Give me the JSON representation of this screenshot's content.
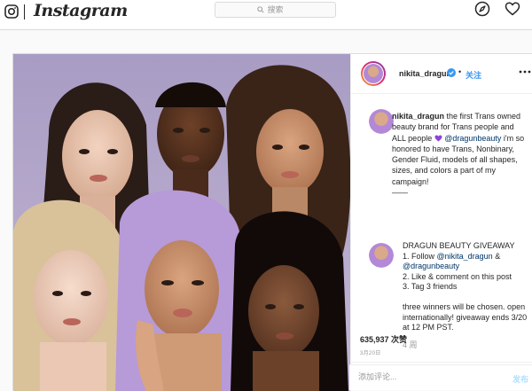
{
  "nav": {
    "logo_text": "Instagram",
    "search_placeholder": "搜索",
    "icons": [
      "camera-icon",
      "compass-icon",
      "heart-icon"
    ]
  },
  "post": {
    "username": "nikita_dragun",
    "follow_label": "关注",
    "header_dot": "•",
    "caption": {
      "user": "nikita_dragun",
      "text_1": " the first Trans owned beauty brand for Trans people and ALL people ",
      "mention_1": "@dragunbeauty",
      "text_2": " i'm so honored to have Trans, Nonbinary, Gender Fluid, models of all shapes, sizes, and colors a part of my campaign!",
      "divider": "——"
    },
    "comment": {
      "line_1": "DRAGUN BEAUTY GIVEAWAY",
      "line_2a": "1. Follow ",
      "mention_2": "@nikita_dragun",
      "line_2b": " &",
      "mention_3": "@dragunbeauty",
      "line_3": "2. Like & comment on this post",
      "line_4": "3. Tag 3 friends",
      "line_5": "three winners will be chosen. open internationally! giveaway ends 3/20 at 12 PM PST.",
      "time_ago": "4 周"
    },
    "likes_text": "635,937 次赞",
    "date_text": "3月20日",
    "comment_placeholder": "添加评论...",
    "post_button": "发布",
    "colors": {
      "link_blue": "#3897f0",
      "mention_blue": "#003569",
      "purple_heart": "#8e44d6",
      "verified_blue": "#3897f0",
      "background_purple": "#b8a9c9"
    }
  }
}
